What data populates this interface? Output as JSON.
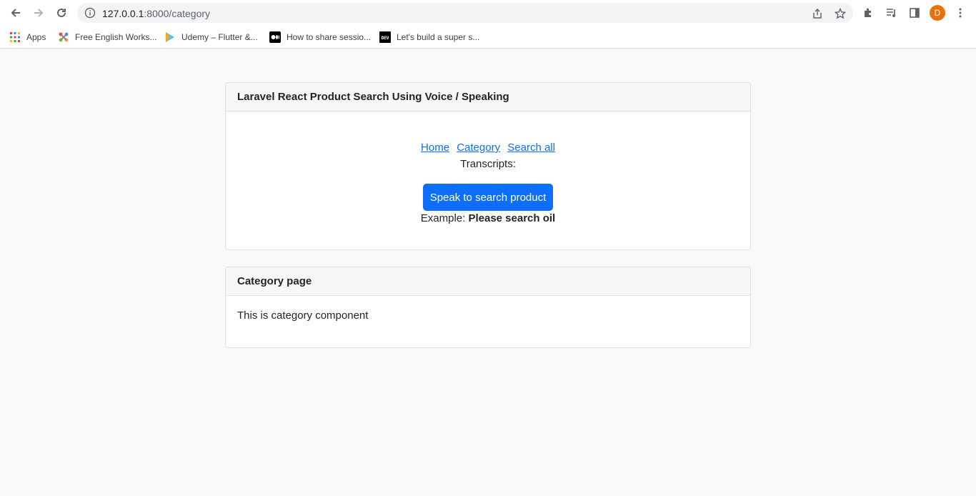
{
  "browser": {
    "url_host": "127.0.0.1",
    "url_path": ":8000/category",
    "profile_initial": "D",
    "bookmarks": [
      {
        "label": "Apps",
        "icon": "apps-grid-icon"
      },
      {
        "label": "Free English Works...",
        "icon": "joomla-icon"
      },
      {
        "label": "Udemy – Flutter &...",
        "icon": "udemy-icon"
      },
      {
        "label": "How to share sessio...",
        "icon": "medium-icon"
      },
      {
        "label": "Let's build a super s...",
        "icon": "dev-icon"
      }
    ]
  },
  "search_card": {
    "title": "Laravel React Product Search Using Voice / Speaking",
    "nav_links": [
      "Home",
      "Category",
      "Search all"
    ],
    "transcripts_label": "Transcripts:",
    "speak_button": "Speak to search product",
    "example_label": "Example:",
    "example_text": "Please search oil"
  },
  "category_card": {
    "title": "Category page",
    "body": "This is category component"
  },
  "colors": {
    "primary": "#0d6efd",
    "page_bg": "#f8f9fa",
    "avatar": "#e8710a"
  }
}
